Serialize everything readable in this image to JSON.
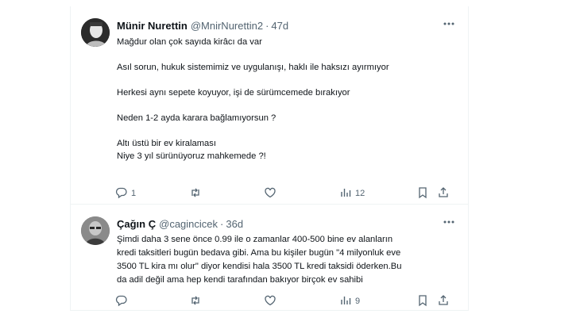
{
  "tweets": [
    {
      "name": "Münir Nurettin",
      "handle": "@MnirNurettin2",
      "dot": "·",
      "time": "47d",
      "lines": [
        "Mağdur olan çok sayıda kirâcı da var",
        "",
        "Asıl sorun, hukuk sistemimiz ve uygulanışı, haklı ile haksızı ayırmıyor",
        "",
        "Herkesi aynı sepete koyuyor, işi de sürümcemede bırakıyor",
        "",
        "Neden 1-2 ayda karara bağlamıyorsun ?",
        "",
        "Altı üstü bir ev kiralaması",
        "Niye 3 yıl sürünüyoruz mahkemede ?!"
      ],
      "replies": "1",
      "retweets": "",
      "likes": "",
      "views": "12"
    },
    {
      "name": "Çağın Ç",
      "handle": "@cagincicek",
      "dot": "·",
      "time": "36d",
      "lines": [
        "Şimdi daha 3 sene önce 0.99 ile o zamanlar 400-500 bine ev alanların",
        "kredi taksitleri bugün bedava gibi. Ama bu kişiler bugün \"4 milyonluk eve",
        "3500 TL kira mı olur\" diyor kendisi hala 3500 TL kredi taksidi öderken.Bu",
        "da adil değil ama hep kendi tarafından bakıyor birçok ev sahibi"
      ],
      "replies": "",
      "retweets": "",
      "likes": "",
      "views": "9"
    }
  ],
  "icons": {
    "more": "more-icon",
    "reply": "reply-icon",
    "retweet": "retweet-icon",
    "like": "like-icon",
    "views": "views-icon",
    "bookmark": "bookmark-icon",
    "share": "share-icon"
  },
  "colors": {
    "text": "#0f1419",
    "secondary": "#536471",
    "border": "#eff3f4"
  }
}
